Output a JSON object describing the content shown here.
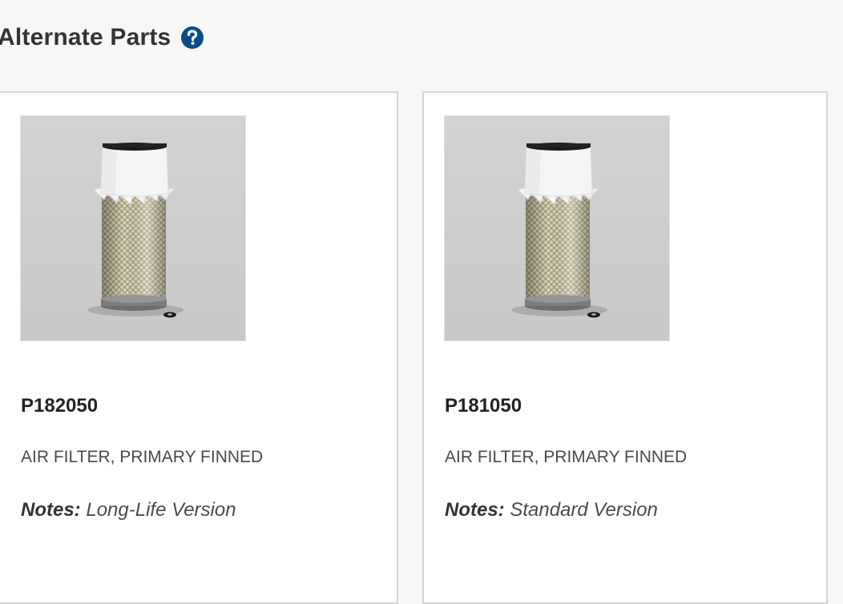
{
  "section": {
    "title": "Alternate Parts",
    "help_icon": "question-circle-icon",
    "accent_color": "#0a4b85"
  },
  "parts": [
    {
      "image_icon": "air-filter-image",
      "part_number": "P182050",
      "description": "AIR FILTER, PRIMARY FINNED",
      "notes_label": "Notes:",
      "notes_value": "Long-Life Version"
    },
    {
      "image_icon": "air-filter-image",
      "part_number": "P181050",
      "description": "AIR FILTER, PRIMARY FINNED",
      "notes_label": "Notes:",
      "notes_value": "Standard Version"
    }
  ]
}
